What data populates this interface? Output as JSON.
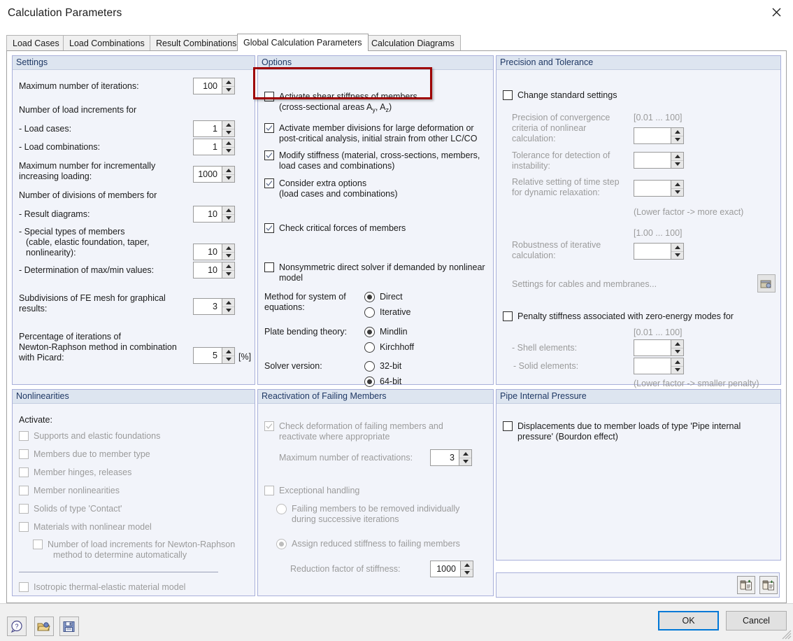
{
  "window": {
    "title": "Calculation Parameters",
    "close_icon": "close-icon"
  },
  "tabs": [
    {
      "label": "Load Cases",
      "active": false
    },
    {
      "label": "Load Combinations",
      "active": false
    },
    {
      "label": "Result Combinations",
      "active": false
    },
    {
      "label": "Global Calculation Parameters",
      "active": true
    },
    {
      "label": "Calculation Diagrams",
      "active": false
    }
  ],
  "settings": {
    "title": "Settings",
    "max_iterations_label": "Maximum number of iterations:",
    "max_iterations_value": "100",
    "load_increments_header": "Number of load increments for",
    "load_cases_label": "- Load cases:",
    "load_cases_value": "1",
    "load_combinations_label": "- Load combinations:",
    "load_combinations_value": "1",
    "incremental_label_1": "Maximum number for incrementally",
    "incremental_label_2": "increasing loading:",
    "incremental_value": "1000",
    "divisions_header": "Number of divisions of members for",
    "result_diagrams_label": "- Result diagrams:",
    "result_diagrams_value": "10",
    "special_types_line1": "- Special types of members",
    "special_types_line2": "(cable, elastic foundation, taper,",
    "special_types_line3": "nonlinearity):",
    "special_types_value": "10",
    "maxmin_label": "- Determination of max/min values:",
    "maxmin_value": "10",
    "fe_mesh_line1": "Subdivisions of FE mesh for graphical",
    "fe_mesh_line2": "results:",
    "fe_mesh_value": "3",
    "picard_line1": "Percentage of iterations of",
    "picard_line2": "Newton-Raphson method in combination",
    "picard_line3": "with Picard:",
    "picard_value": "5",
    "picard_unit": "[%]"
  },
  "options": {
    "title": "Options",
    "shear_stiffness_line1": "Activate shear stiffness of members",
    "shear_stiffness_line2_a": "(cross-sectional areas A",
    "shear_stiffness_sub_y": "y",
    "shear_stiffness_line2_b": ", A",
    "shear_stiffness_sub_z": "z",
    "shear_stiffness_line2_c": ")",
    "shear_stiffness_checked": false,
    "member_divisions_line1": "Activate member divisions for large deformation or",
    "member_divisions_line2": "post-critical analysis, initial strain from other LC/CO",
    "member_divisions_checked": true,
    "modify_stiffness_line1": "Modify stiffness (material, cross-sections, members,",
    "modify_stiffness_line2": "load cases and combinations)",
    "modify_stiffness_checked": true,
    "extra_options_line1": "Consider extra options",
    "extra_options_line2": "(load cases and combinations)",
    "extra_options_checked": true,
    "critical_forces_label": "Check critical forces of members",
    "critical_forces_checked": true,
    "nonsymmetric_line1": "Nonsymmetric direct solver if demanded by nonlinear",
    "nonsymmetric_line2": "model",
    "nonsymmetric_checked": false,
    "method_label_line1": "Method for system of",
    "method_label_line2": "equations:",
    "method_direct": "Direct",
    "method_iterative": "Iterative",
    "method_selected": "Direct",
    "plate_label": "Plate bending theory:",
    "plate_mindlin": "Mindlin",
    "plate_kirchhoff": "Kirchhoff",
    "plate_selected": "Mindlin",
    "solver_label": "Solver version:",
    "solver_32": "32-bit",
    "solver_64": "64-bit",
    "solver_selected": "64-bit"
  },
  "precision": {
    "title": "Precision and Tolerance",
    "change_standard_label": "Change standard settings",
    "change_standard_checked": false,
    "convergence_line1": "Precision of convergence",
    "convergence_line2": "criteria of nonlinear",
    "convergence_line3": "calculation:",
    "convergence_range": "[0.01 ... 100]",
    "convergence_value": "",
    "instability_line1": "Tolerance for detection of",
    "instability_line2": "instability:",
    "instability_value": "",
    "timestep_line1": "Relative setting of time step",
    "timestep_line2": "for dynamic relaxation:",
    "timestep_value": "",
    "lower_factor_exact": "(Lower factor -> more exact)",
    "robustness_range": "[1.00 ... 100]",
    "robustness_line1": "Robustness of iterative",
    "robustness_line2": "calculation:",
    "robustness_value": "",
    "cables_membranes_label": "Settings for cables and membranes...",
    "cables_membranes_icon": "settings-dialog-icon",
    "penalty_label": "Penalty stiffness associated with zero-energy modes for",
    "penalty_checked": false,
    "penalty_range": "[0.01 ... 100]",
    "shell_label": "- Shell elements:",
    "shell_value": "",
    "solid_label": "- Solid elements:",
    "solid_value": "",
    "lower_factor_penalty": "(Lower factor -> smaller penalty)"
  },
  "nonlinearities": {
    "title": "Nonlinearities",
    "activate_label": "Activate:",
    "items": [
      {
        "label": "Supports and elastic foundations",
        "checked": false
      },
      {
        "label": "Members due to member type",
        "checked": false
      },
      {
        "label": "Member hinges, releases",
        "checked": false
      },
      {
        "label": "Member nonlinearities",
        "checked": false
      },
      {
        "label": "Solids of type 'Contact'",
        "checked": false
      },
      {
        "label": "Materials with nonlinear model",
        "checked": false
      }
    ],
    "newton_raphson_line1": "Number of load increments for Newton-Raphson",
    "newton_raphson_line2": "method to determine automatically",
    "newton_raphson_checked": false,
    "isotropic_label": "Isotropic thermal-elastic material model",
    "isotropic_checked": false
  },
  "reactivation": {
    "title": "Reactivation of Failing Members",
    "check_deformation_line1": "Check deformation of failing members and",
    "check_deformation_line2": "reactivate where appropriate",
    "check_deformation_checked": true,
    "max_reactivations_label": "Maximum number of reactivations:",
    "max_reactivations_value": "3",
    "exceptional_label": "Exceptional handling",
    "exceptional_checked": false,
    "failing_removed_line1": "Failing members to be removed individually",
    "failing_removed_line2": "during successive iterations",
    "assign_reduced_label": "Assign reduced stiffness to failing members",
    "radio_selected": "Assign reduced stiffness to failing members",
    "reduction_factor_label": "Reduction factor of stiffness:",
    "reduction_factor_value": "1000"
  },
  "pipe": {
    "title": "Pipe Internal Pressure",
    "displacements_line1": "Displacements due to member loads of type 'Pipe internal",
    "displacements_line2": "pressure' (Bourdon effect)",
    "displacements_checked": false
  },
  "bottom_bar": {
    "help_icon": "help-icon",
    "open_icon": "open-folder-icon",
    "save_icon": "save-icon",
    "ok_label": "OK",
    "cancel_label": "Cancel",
    "import_icon": "import-from-library-icon",
    "export_icon": "export-to-library-icon"
  }
}
